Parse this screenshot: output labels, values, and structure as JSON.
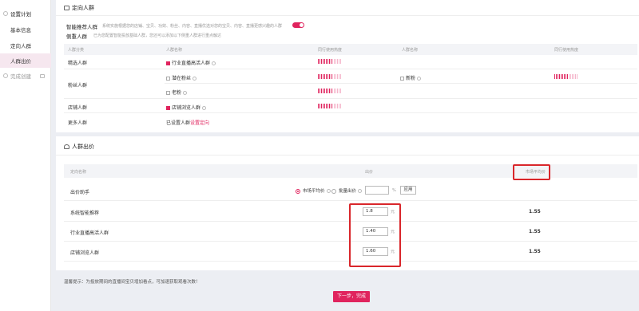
{
  "sidebar": {
    "title": "设置计划",
    "items": [
      {
        "label": "基本信息"
      },
      {
        "label": "定向人群"
      },
      {
        "label": "人群出价"
      }
    ],
    "done": "完成创建"
  },
  "crowd": {
    "title": "定向人群",
    "smart_label": "智能推荐人群",
    "smart_desc": "系统实施根据您的店铺、宝贝、功效、粉丝、内容、直播优选对您的宝贝、内容、直播更感兴趣的人群",
    "focus_label": "侧重人群",
    "focus_desc": "已为您配置智能投放基础人群，您还可以添加以下侧重人群进行重点触达",
    "headers": [
      "人群分类",
      "人群名称",
      "同行使用热度",
      "人群名称",
      "同行使用热度"
    ],
    "rows": [
      {
        "category": "精选人群",
        "name": "行业直播高活人群"
      },
      {
        "category": "粉丝人群",
        "name": "潜在粉丝",
        "name_b": "新粉",
        "name2": "老粉"
      },
      {
        "category": "店铺人群",
        "name": "店铺浏览人群"
      },
      {
        "category": "更多人群",
        "name": "已设置人群",
        "link": "设置定向"
      }
    ]
  },
  "bid": {
    "title": "人群出价",
    "headers": [
      "定向名称",
      "出价",
      "市场平均价"
    ],
    "helper_label": "出价助手",
    "opt_market": "市场平均价",
    "opt_batch": "批量出价",
    "percent": "%",
    "apply": "应用",
    "unit": "元",
    "rows": [
      {
        "name": "系统智能推荐",
        "bid": "1.8",
        "avg": "1.55"
      },
      {
        "name": "行业直播高活人群",
        "bid": "1.40",
        "avg": "1.55"
      },
      {
        "name": "店铺浏览人群",
        "bid": "1.60",
        "avg": "1.55"
      }
    ]
  },
  "footer": {
    "tip": "温馨提示：为投放期间的直播间宝贝增加看点，可加速获取观看次数！",
    "next": "下一步，完成"
  },
  "colors": {
    "accent": "#e0245e",
    "highlight_box": "#d9262b"
  }
}
